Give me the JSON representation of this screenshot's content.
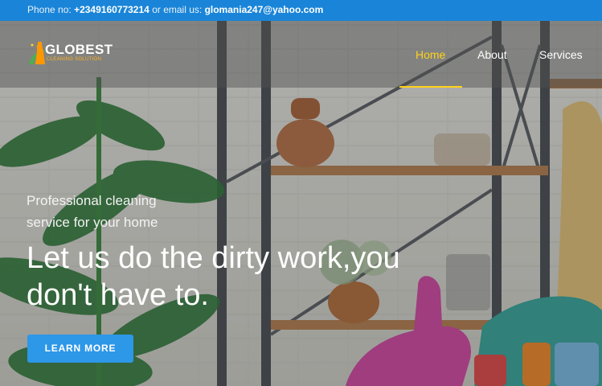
{
  "topbar": {
    "phone_label": "Phone no:",
    "phone": "+2349160773214",
    "email_label": "or email us:",
    "email": "glomania247@yahoo.com"
  },
  "brand": {
    "name": "GLOBEST",
    "subtitle": "CLEANING SOLUTION",
    "logo_icon": "spray-bottle-swoosh-icon"
  },
  "nav": {
    "items": [
      {
        "label": "Home",
        "active": true
      },
      {
        "label": "About",
        "active": false
      },
      {
        "label": "Services",
        "active": false
      }
    ]
  },
  "hero": {
    "tagline": "Professional cleaning service for your home",
    "headline": "Let us do the dirty work,you don't have to.",
    "cta_label": "LEARN MORE",
    "image": "woman in pink gloves giving thumbs up with cleaning supplies in front of shelves and plants"
  },
  "colors": {
    "topbar": "#1a85d8",
    "accent_yellow": "#ffd21a",
    "cta_blue": "#2d97e8"
  }
}
